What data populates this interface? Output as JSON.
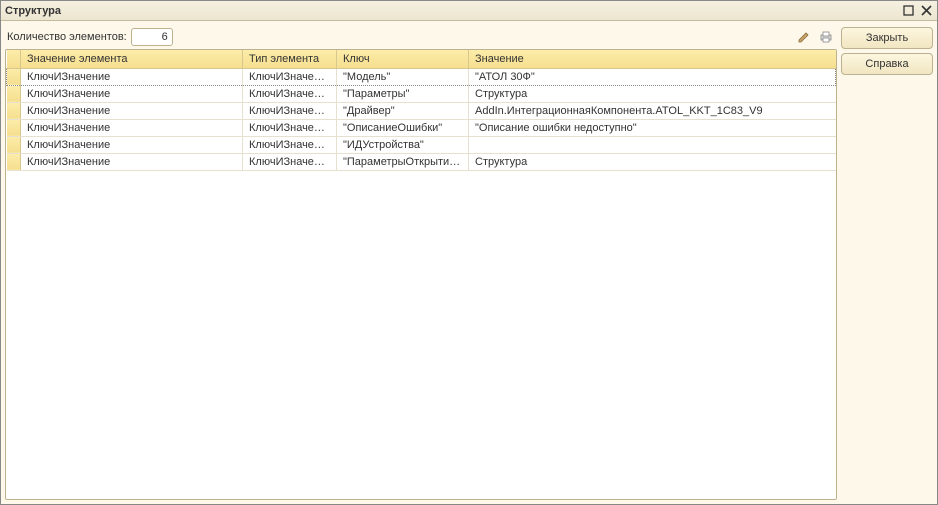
{
  "window": {
    "title": "Структура"
  },
  "toolbar": {
    "count_label": "Количество элементов:",
    "count_value": "6"
  },
  "buttons": {
    "close": "Закрыть",
    "help": "Справка"
  },
  "columns": {
    "c0": "",
    "c1": "Значение элемента",
    "c2": "Тип элемента",
    "c3": "Ключ",
    "c4": "Значение"
  },
  "rows": [
    {
      "val_elem": "КлючИЗначение",
      "type_elem": "КлючИЗначение",
      "key": "\"Модель\"",
      "value": "\"АТОЛ 30Ф\""
    },
    {
      "val_elem": "КлючИЗначение",
      "type_elem": "КлючИЗначение",
      "key": "\"Параметры\"",
      "value": "Структура"
    },
    {
      "val_elem": "КлючИЗначение",
      "type_elem": "КлючИЗначение",
      "key": "\"Драйвер\"",
      "value": "AddIn.ИнтеграционнаяКомпонента.ATOL_KKT_1C83_V9"
    },
    {
      "val_elem": "КлючИЗначение",
      "type_elem": "КлючИЗначение",
      "key": "\"ОписаниеОшибки\"",
      "value": "\"Описание ошибки недоступно\""
    },
    {
      "val_elem": "КлючИЗначение",
      "type_elem": "КлючИЗначение",
      "key": "\"ИДУстройства\"",
      "value": ""
    },
    {
      "val_elem": "КлючИЗначение",
      "type_elem": "КлючИЗначение",
      "key": "\"ПараметрыОткрытия…",
      "value": "Структура"
    }
  ]
}
